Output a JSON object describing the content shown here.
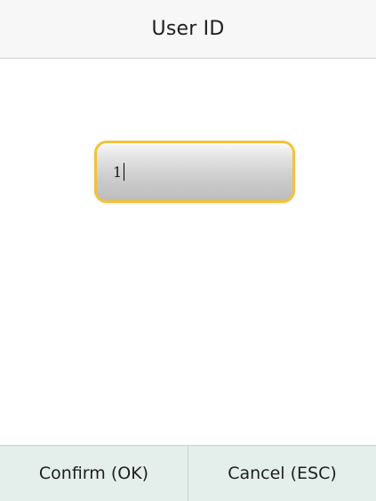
{
  "header": {
    "title": "User ID"
  },
  "input": {
    "value": "1"
  },
  "footer": {
    "confirm_label": "Confirm (OK)",
    "cancel_label": "Cancel (ESC)"
  },
  "colors": {
    "header_bg": "#f6f7f6",
    "input_border": "#f1c33a",
    "footer_bg": "#e4efec"
  }
}
